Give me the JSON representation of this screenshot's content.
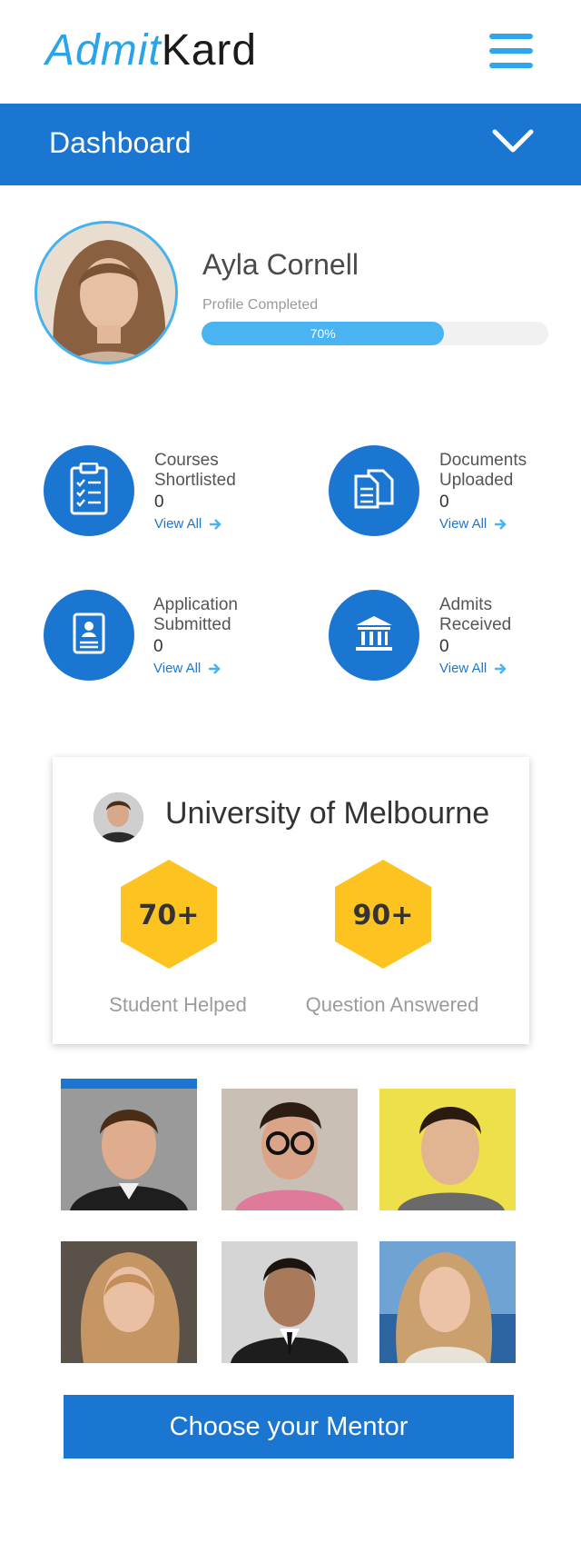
{
  "header": {
    "logo_part1": "Admit",
    "logo_part2": "Kard",
    "menu_icon": "hamburger-menu-icon"
  },
  "dashboard": {
    "title": "Dashboard",
    "toggle_icon": "chevron-down-icon"
  },
  "profile": {
    "name": "Ayla Cornell",
    "completed_label": "Profile Completed",
    "progress_text": "70%",
    "progress_value": 0.7
  },
  "stats": [
    {
      "label_line1": "Courses",
      "label_line2": "Shortlisted",
      "count": "0",
      "link": "View All",
      "icon": "clipboard-checklist-icon"
    },
    {
      "label_line1": "Documents",
      "label_line2": "Uploaded",
      "count": "0",
      "link": "View All",
      "icon": "documents-icon"
    },
    {
      "label_line1": "Application",
      "label_line2": "Submitted",
      "count": "0",
      "link": "View All",
      "icon": "id-card-icon"
    },
    {
      "label_line1": "Admits",
      "label_line2": "Received",
      "count": "0",
      "link": "View All",
      "icon": "university-building-icon"
    }
  ],
  "university": {
    "name": "University of Melbourne",
    "metrics": [
      {
        "value": "70+",
        "label": "Student Helped"
      },
      {
        "value": "90+",
        "label": "Question Answered"
      }
    ]
  },
  "mentors": {
    "selected_index": 0,
    "count": 6
  },
  "cta": {
    "label": "Choose your Mentor"
  },
  "colors": {
    "primary": "#1b76d2",
    "accent": "#4ab4f3",
    "hexagon": "#fdc421"
  }
}
